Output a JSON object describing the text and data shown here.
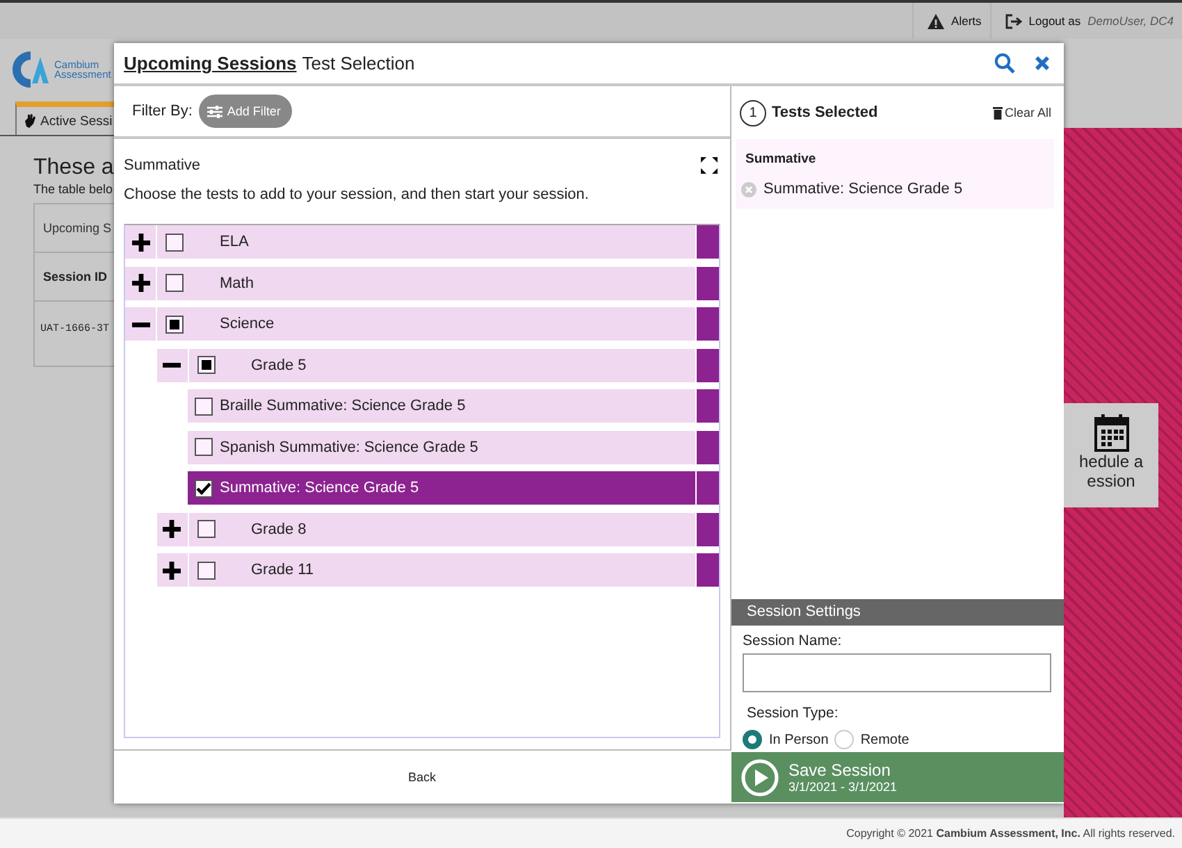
{
  "top_bar": {
    "alerts": "Alerts",
    "logout_label": "Logout as",
    "user": "DemoUser, DC4"
  },
  "background": {
    "logo_line_1": "Cambium",
    "logo_line_2": "Assessment",
    "tab": "Active Sessi",
    "heading": "These a",
    "subtext": "The table belo",
    "table_header": "Upcoming S",
    "column_1": "Session ID",
    "cell": "UAT-1666-3T",
    "schedule_line_1": "hedule a",
    "schedule_line_2": "ession"
  },
  "modal": {
    "title_link": "Upcoming Sessions",
    "title": "Test Selection",
    "filter_label": "Filter By:",
    "add_filter": "Add Filter",
    "section": "Summative",
    "instruction": "Choose the tests to add to your session, and then start your session.",
    "tree": [
      {
        "kind": "group",
        "label": "ELA",
        "expanded": false,
        "checked": false,
        "partial": false
      },
      {
        "kind": "group",
        "label": "Math",
        "expanded": false,
        "checked": false,
        "partial": false
      },
      {
        "kind": "group",
        "label": "Science",
        "expanded": true,
        "checked": false,
        "partial": true,
        "children": [
          {
            "kind": "group",
            "label": "Grade 5",
            "expanded": true,
            "checked": false,
            "partial": true,
            "children": [
              {
                "kind": "test",
                "label": "Braille Summative: Science Grade 5",
                "checked": false
              },
              {
                "kind": "test",
                "label": "Spanish Summative: Science Grade 5",
                "checked": false
              },
              {
                "kind": "test",
                "label": "Summative: Science Grade 5",
                "checked": true
              }
            ]
          },
          {
            "kind": "group",
            "label": "Grade 8",
            "expanded": false,
            "checked": false,
            "partial": false
          },
          {
            "kind": "group",
            "label": "Grade 11",
            "expanded": false,
            "checked": false,
            "partial": false
          }
        ]
      }
    ],
    "back": "Back",
    "selected_count": "1",
    "selected_title": "Tests Selected",
    "clear_all": "Clear All",
    "selected_group": "Summative",
    "selected_items": [
      "Summative: Science Grade 5"
    ],
    "settings_title": "Session Settings",
    "name_label": "Session Name:",
    "type_label": "Session Type:",
    "session_types": [
      {
        "label": "In Person",
        "selected": true
      },
      {
        "label": "Remote",
        "selected": false
      }
    ],
    "save": "Save Session",
    "save_dates": "3/1/2021 - 3/1/2021"
  },
  "footer": "Copyright © 2021 **Cambium Assessment, Inc.** All rights reserved."
}
